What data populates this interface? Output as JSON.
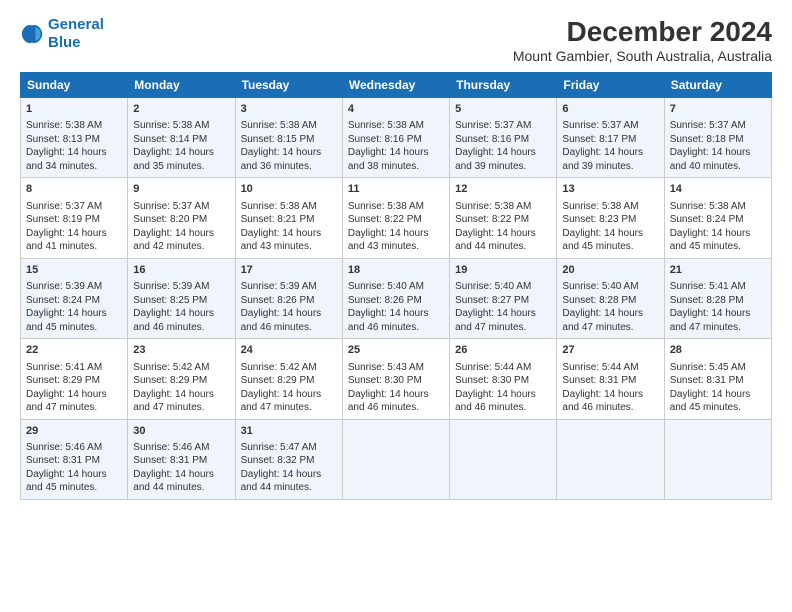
{
  "logo": {
    "line1": "General",
    "line2": "Blue"
  },
  "title": "December 2024",
  "subtitle": "Mount Gambier, South Australia, Australia",
  "headers": [
    "Sunday",
    "Monday",
    "Tuesday",
    "Wednesday",
    "Thursday",
    "Friday",
    "Saturday"
  ],
  "weeks": [
    [
      {
        "day": "1",
        "info": "Sunrise: 5:38 AM\nSunset: 8:13 PM\nDaylight: 14 hours\nand 34 minutes."
      },
      {
        "day": "2",
        "info": "Sunrise: 5:38 AM\nSunset: 8:14 PM\nDaylight: 14 hours\nand 35 minutes."
      },
      {
        "day": "3",
        "info": "Sunrise: 5:38 AM\nSunset: 8:15 PM\nDaylight: 14 hours\nand 36 minutes."
      },
      {
        "day": "4",
        "info": "Sunrise: 5:38 AM\nSunset: 8:16 PM\nDaylight: 14 hours\nand 38 minutes."
      },
      {
        "day": "5",
        "info": "Sunrise: 5:37 AM\nSunset: 8:16 PM\nDaylight: 14 hours\nand 39 minutes."
      },
      {
        "day": "6",
        "info": "Sunrise: 5:37 AM\nSunset: 8:17 PM\nDaylight: 14 hours\nand 39 minutes."
      },
      {
        "day": "7",
        "info": "Sunrise: 5:37 AM\nSunset: 8:18 PM\nDaylight: 14 hours\nand 40 minutes."
      }
    ],
    [
      {
        "day": "8",
        "info": "Sunrise: 5:37 AM\nSunset: 8:19 PM\nDaylight: 14 hours\nand 41 minutes."
      },
      {
        "day": "9",
        "info": "Sunrise: 5:37 AM\nSunset: 8:20 PM\nDaylight: 14 hours\nand 42 minutes."
      },
      {
        "day": "10",
        "info": "Sunrise: 5:38 AM\nSunset: 8:21 PM\nDaylight: 14 hours\nand 43 minutes."
      },
      {
        "day": "11",
        "info": "Sunrise: 5:38 AM\nSunset: 8:22 PM\nDaylight: 14 hours\nand 43 minutes."
      },
      {
        "day": "12",
        "info": "Sunrise: 5:38 AM\nSunset: 8:22 PM\nDaylight: 14 hours\nand 44 minutes."
      },
      {
        "day": "13",
        "info": "Sunrise: 5:38 AM\nSunset: 8:23 PM\nDaylight: 14 hours\nand 45 minutes."
      },
      {
        "day": "14",
        "info": "Sunrise: 5:38 AM\nSunset: 8:24 PM\nDaylight: 14 hours\nand 45 minutes."
      }
    ],
    [
      {
        "day": "15",
        "info": "Sunrise: 5:39 AM\nSunset: 8:24 PM\nDaylight: 14 hours\nand 45 minutes."
      },
      {
        "day": "16",
        "info": "Sunrise: 5:39 AM\nSunset: 8:25 PM\nDaylight: 14 hours\nand 46 minutes."
      },
      {
        "day": "17",
        "info": "Sunrise: 5:39 AM\nSunset: 8:26 PM\nDaylight: 14 hours\nand 46 minutes."
      },
      {
        "day": "18",
        "info": "Sunrise: 5:40 AM\nSunset: 8:26 PM\nDaylight: 14 hours\nand 46 minutes."
      },
      {
        "day": "19",
        "info": "Sunrise: 5:40 AM\nSunset: 8:27 PM\nDaylight: 14 hours\nand 47 minutes."
      },
      {
        "day": "20",
        "info": "Sunrise: 5:40 AM\nSunset: 8:28 PM\nDaylight: 14 hours\nand 47 minutes."
      },
      {
        "day": "21",
        "info": "Sunrise: 5:41 AM\nSunset: 8:28 PM\nDaylight: 14 hours\nand 47 minutes."
      }
    ],
    [
      {
        "day": "22",
        "info": "Sunrise: 5:41 AM\nSunset: 8:29 PM\nDaylight: 14 hours\nand 47 minutes."
      },
      {
        "day": "23",
        "info": "Sunrise: 5:42 AM\nSunset: 8:29 PM\nDaylight: 14 hours\nand 47 minutes."
      },
      {
        "day": "24",
        "info": "Sunrise: 5:42 AM\nSunset: 8:29 PM\nDaylight: 14 hours\nand 47 minutes."
      },
      {
        "day": "25",
        "info": "Sunrise: 5:43 AM\nSunset: 8:30 PM\nDaylight: 14 hours\nand 46 minutes."
      },
      {
        "day": "26",
        "info": "Sunrise: 5:44 AM\nSunset: 8:30 PM\nDaylight: 14 hours\nand 46 minutes."
      },
      {
        "day": "27",
        "info": "Sunrise: 5:44 AM\nSunset: 8:31 PM\nDaylight: 14 hours\nand 46 minutes."
      },
      {
        "day": "28",
        "info": "Sunrise: 5:45 AM\nSunset: 8:31 PM\nDaylight: 14 hours\nand 45 minutes."
      }
    ],
    [
      {
        "day": "29",
        "info": "Sunrise: 5:46 AM\nSunset: 8:31 PM\nDaylight: 14 hours\nand 45 minutes."
      },
      {
        "day": "30",
        "info": "Sunrise: 5:46 AM\nSunset: 8:31 PM\nDaylight: 14 hours\nand 44 minutes."
      },
      {
        "day": "31",
        "info": "Sunrise: 5:47 AM\nSunset: 8:32 PM\nDaylight: 14 hours\nand 44 minutes."
      },
      null,
      null,
      null,
      null
    ]
  ]
}
